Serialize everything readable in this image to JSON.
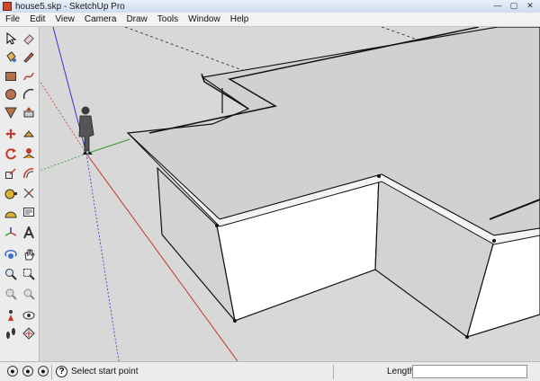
{
  "window": {
    "title": "house5.skp - SketchUp Pro",
    "controls": [
      "—",
      "▢",
      "✕"
    ]
  },
  "menu": [
    "File",
    "Edit",
    "View",
    "Camera",
    "Draw",
    "Tools",
    "Window",
    "Help"
  ],
  "toolbar": {
    "tools": [
      "select",
      "eraser",
      "paint-bucket",
      "pencil-line",
      "rectangle",
      "freehand",
      "circle",
      "arc",
      "polygon",
      "push-pull",
      "move",
      "follow-me",
      "rotate",
      "follow-me-2",
      "scale",
      "offset",
      "tape-measure",
      "dimension",
      "protractor",
      "text",
      "axes",
      "3d-text",
      "orbit",
      "pan",
      "zoom-window",
      "zoom",
      "previous-view",
      "next-view",
      "position-camera",
      "look-around",
      "walk",
      "section-plane"
    ]
  },
  "status": {
    "hint": "Select start point",
    "length_label": "Length",
    "length_value": ""
  },
  "colors": {
    "viewport_bg": "#d8d8d8",
    "face_light": "#ffffff",
    "face_dark": "#d3d3d3",
    "roof_top": "#d1d1d1",
    "axis_red": "#c0392b",
    "axis_green": "#2e9b2e",
    "axis_blue": "#3333cc"
  }
}
